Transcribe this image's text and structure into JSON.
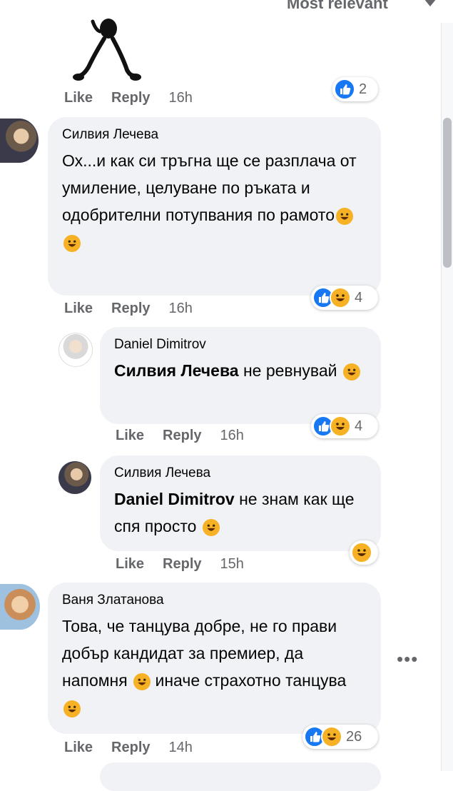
{
  "header": {
    "sort_label": "Most relevant"
  },
  "top_comment": {
    "like": "Like",
    "reply": "Reply",
    "time": "16h",
    "reaction_count": "2"
  },
  "comments": [
    {
      "author": "Силвия Лечева",
      "text": "Ох...и как си тръгна ще се разплача от умиление, целуване по ръката и одобрителни потупвания по рамото",
      "like": "Like",
      "reply": "Reply",
      "time": "16h",
      "reaction_count": "4"
    },
    {
      "author": "Daniel Dimitrov",
      "mention": "Силвия Лечева",
      "text": "не ревнувай",
      "like": "Like",
      "reply": "Reply",
      "time": "16h",
      "reaction_count": "4"
    },
    {
      "author": "Силвия Лечева",
      "mention": "Daniel Dimitrov",
      "text": "не знам как ще спя просто",
      "like": "Like",
      "reply": "Reply",
      "time": "15h"
    },
    {
      "author": "Ваня Златанова",
      "text_a": "Това, че танцува добре, не го прави добър кандидат за премиер, да напомня",
      "text_b": "иначе страхотно танцува",
      "like": "Like",
      "reply": "Reply",
      "time": "14h",
      "reaction_count": "26"
    }
  ],
  "colors": {
    "like_blue": "#1877f2",
    "haha_yellow": "#f7b125",
    "bubble_gray": "#f0f2f5",
    "meta_gray": "#65676b"
  },
  "icons": [
    "like-icon",
    "haha-icon",
    "more-options-icon",
    "sort-caret-icon"
  ]
}
